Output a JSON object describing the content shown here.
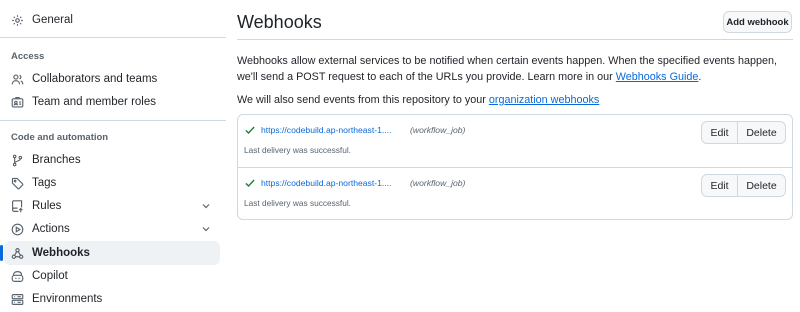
{
  "sidebar": {
    "general": "General",
    "access_heading": "Access",
    "access_items": [
      {
        "label": "Collaborators and teams",
        "icon": "people-icon"
      },
      {
        "label": "Team and member roles",
        "icon": "id-badge-icon"
      }
    ],
    "code_heading": "Code and automation",
    "code_items": [
      {
        "label": "Branches",
        "icon": "git-branch-icon"
      },
      {
        "label": "Tags",
        "icon": "tag-icon"
      },
      {
        "label": "Rules",
        "icon": "repo-push-icon",
        "expandable": true
      },
      {
        "label": "Actions",
        "icon": "play-icon",
        "expandable": true
      },
      {
        "label": "Webhooks",
        "icon": "webhook-icon",
        "active": true
      },
      {
        "label": "Copilot",
        "icon": "copilot-icon"
      },
      {
        "label": "Environments",
        "icon": "server-icon"
      }
    ]
  },
  "main": {
    "title": "Webhooks",
    "add_button": "Add webhook",
    "description_1": "Webhooks allow external services to be notified when certain events happen. When the specified events happen, we'll send a POST request to each of the URLs you provide. Learn more in our ",
    "description_link": "Webhooks Guide",
    "description_end": ".",
    "description_2": "We will also send events from this repository to your ",
    "description_2_link": "organization webhooks",
    "webhooks": [
      {
        "url": "https://codebuild.ap-northeast-1....",
        "event": "(workflow_job)",
        "status": "Last delivery was successful.",
        "edit": "Edit",
        "delete": "Delete"
      },
      {
        "url": "https://codebuild.ap-northeast-1....",
        "event": "(workflow_job)",
        "status": "Last delivery was successful.",
        "edit": "Edit",
        "delete": "Delete"
      }
    ]
  },
  "colors": {
    "accent": "#0969da",
    "success": "#1a7f37",
    "active_bg": "#eff2f5"
  }
}
